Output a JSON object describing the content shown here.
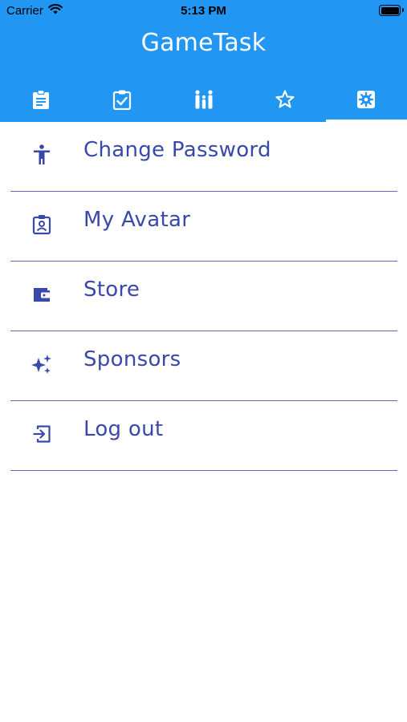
{
  "status_bar": {
    "carrier": "Carrier",
    "time": "5:13 PM"
  },
  "app": {
    "title": "GameTask"
  },
  "tabs": [
    {
      "icon": "clipboard-icon",
      "active": false
    },
    {
      "icon": "checklist-icon",
      "active": false
    },
    {
      "icon": "family-icon",
      "active": false
    },
    {
      "icon": "star-icon",
      "active": false
    },
    {
      "icon": "settings-icon",
      "active": true
    }
  ],
  "menu": {
    "items": [
      {
        "label": "Change Password",
        "icon": "accessibility-icon"
      },
      {
        "label": "My Avatar",
        "icon": "badge-icon"
      },
      {
        "label": "Store",
        "icon": "wallet-icon"
      },
      {
        "label": "Sponsors",
        "icon": "sparkles-icon"
      },
      {
        "label": "Log out",
        "icon": "logout-icon"
      }
    ]
  },
  "colors": {
    "primary": "#2196f3",
    "menu_text": "#3949ab",
    "divider": "#5c6bc0"
  }
}
